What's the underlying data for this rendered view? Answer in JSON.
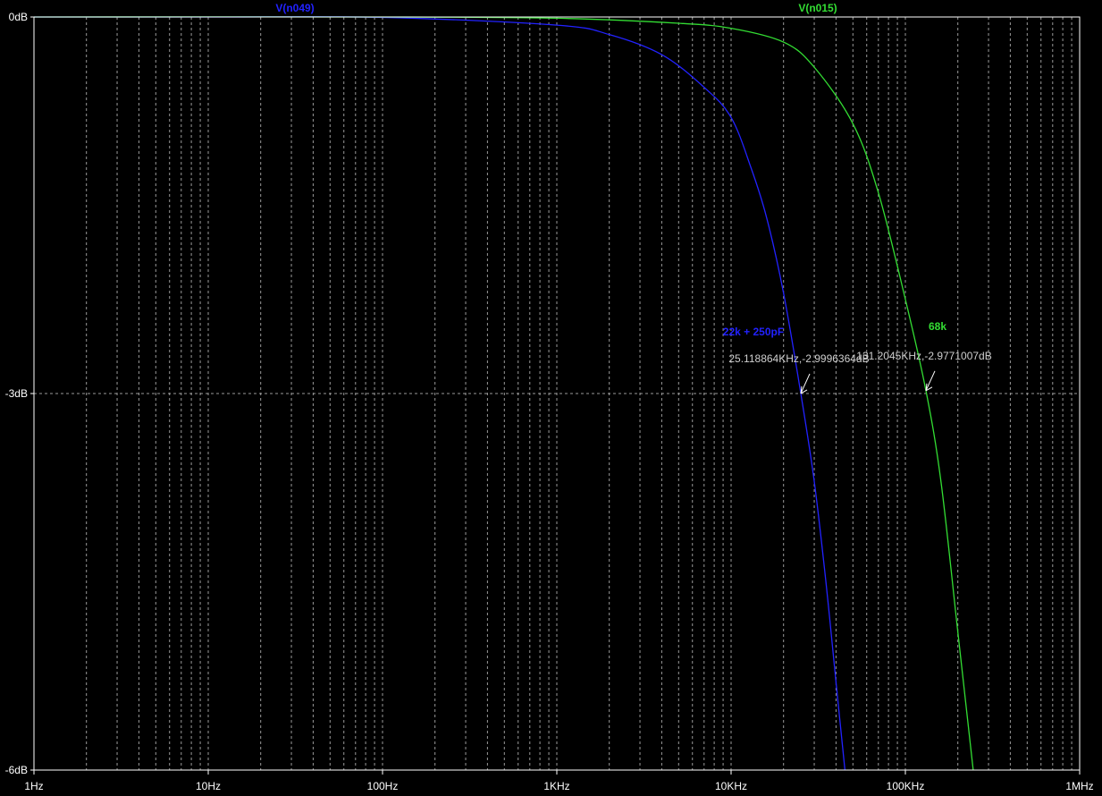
{
  "chart_data": {
    "type": "line",
    "x_scale": "log",
    "xlim": [
      1,
      1000000
    ],
    "ylim": [
      -6,
      0
    ],
    "x_ticks": [
      {
        "value": 1,
        "label": "1Hz"
      },
      {
        "value": 10,
        "label": "10Hz"
      },
      {
        "value": 100,
        "label": "100Hz"
      },
      {
        "value": 1000,
        "label": "1KHz"
      },
      {
        "value": 10000,
        "label": "10KHz"
      },
      {
        "value": 100000,
        "label": "100KHz"
      },
      {
        "value": 1000000,
        "label": "1MHz"
      }
    ],
    "y_ticks": [
      {
        "value": 0,
        "label": "0dB"
      },
      {
        "value": -3,
        "label": "-3dB"
      },
      {
        "value": -6,
        "label": "-6dB"
      }
    ],
    "grid": true,
    "series": [
      {
        "name": "V(n049)",
        "color": "#2222ff",
        "annotation": "22k + 250pF",
        "points": [
          [
            1,
            0.0
          ],
          [
            10,
            0.0
          ],
          [
            100,
            -0.003
          ],
          [
            1000,
            -0.065
          ],
          [
            2000,
            -0.14
          ],
          [
            4000,
            -0.3
          ],
          [
            7000,
            -0.56
          ],
          [
            10000,
            -0.8
          ],
          [
            13000,
            -1.2
          ],
          [
            16000,
            -1.6
          ],
          [
            20000,
            -2.2
          ],
          [
            25118.864,
            -2.9996364
          ],
          [
            30000,
            -3.7
          ],
          [
            35000,
            -4.5
          ],
          [
            40000,
            -5.3
          ],
          [
            45000,
            -6.0
          ]
        ]
      },
      {
        "name": "V(n015)",
        "color": "#33dd33",
        "annotation": "68k",
        "points": [
          [
            1,
            0.0
          ],
          [
            100,
            0.0
          ],
          [
            1000,
            -0.01
          ],
          [
            5000,
            -0.05
          ],
          [
            10000,
            -0.09
          ],
          [
            20000,
            -0.2
          ],
          [
            30000,
            -0.4
          ],
          [
            50000,
            -0.85
          ],
          [
            70000,
            -1.4
          ],
          [
            100000,
            -2.25
          ],
          [
            131204.5,
            -2.9771007
          ],
          [
            160000,
            -3.7
          ],
          [
            200000,
            -4.9
          ],
          [
            245000,
            -6.0
          ]
        ]
      }
    ],
    "cursors": [
      {
        "x": 25118.864,
        "y": -2.9996364,
        "label": "25.118864KHz,-2.9996364dB"
      },
      {
        "x": 131204.5,
        "y": -2.9771007,
        "label": "131.2045KHz,-2.9771007dB"
      }
    ],
    "colors": {
      "background": "#000000",
      "axis": "#ffffff",
      "grid": "#9a9a9a",
      "tick_text": "#ffffff",
      "cursor_text": "#cfcfcf"
    }
  }
}
